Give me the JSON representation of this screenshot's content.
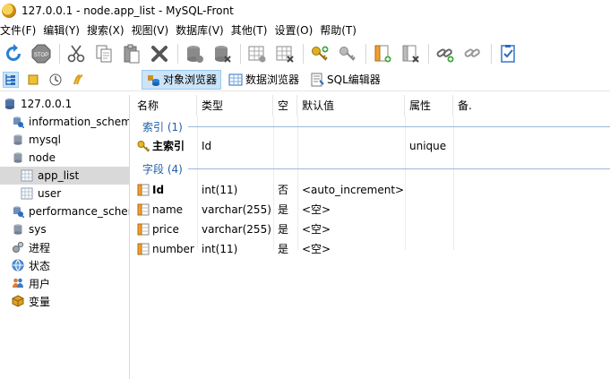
{
  "window": {
    "title": "127.0.0.1 - node.app_list - MySQL-Front"
  },
  "menu": [
    "文件(F)",
    "编辑(Y)",
    "搜索(X)",
    "视图(V)",
    "数据库(V)",
    "其他(T)",
    "设置(O)",
    "帮助(T)"
  ],
  "toolbar": {
    "icons": [
      "refresh-icon",
      "stop-icon",
      "cut-icon",
      "copy-icon",
      "paste-icon",
      "delete-icon",
      "new-database-icon",
      "drop-database-icon",
      "new-table-icon",
      "drop-table-icon",
      "new-key-icon",
      "drop-key-icon",
      "new-field-icon",
      "drop-field-icon",
      "new-link-icon",
      "drop-link-icon",
      "properties-icon"
    ],
    "stop_label": "STOP"
  },
  "view_tabs": [
    {
      "label": "对象浏览器",
      "active": true
    },
    {
      "label": "数据浏览器",
      "active": false
    },
    {
      "label": "SQL编辑器",
      "active": false
    }
  ],
  "tree": {
    "items": [
      {
        "label": "127.0.0.1",
        "level": 0,
        "icon": "server-icon"
      },
      {
        "label": "information_schem",
        "level": 1,
        "icon": "database-system-icon"
      },
      {
        "label": "mysql",
        "level": 1,
        "icon": "database-icon"
      },
      {
        "label": "node",
        "level": 1,
        "icon": "database-icon"
      },
      {
        "label": "app_list",
        "level": 2,
        "icon": "table-icon",
        "selected": true
      },
      {
        "label": "user",
        "level": 2,
        "icon": "table-icon"
      },
      {
        "label": "performance_scher",
        "level": 1,
        "icon": "database-system-icon"
      },
      {
        "label": "sys",
        "level": 1,
        "icon": "database-icon"
      },
      {
        "label": "进程",
        "level": 1,
        "icon": "process-icon"
      },
      {
        "label": "状态",
        "level": 1,
        "icon": "status-icon"
      },
      {
        "label": "用户",
        "level": 1,
        "icon": "users-icon"
      },
      {
        "label": "变量",
        "level": 1,
        "icon": "variables-icon"
      }
    ]
  },
  "grid": {
    "columns": [
      "名称",
      "类型",
      "空",
      "默认值",
      "属性",
      "备."
    ],
    "index_section": "索引 (1)",
    "index_rows": [
      {
        "name": "主索引",
        "type": "Id",
        "null": "",
        "default": "",
        "attr": "unique"
      }
    ],
    "field_section": "字段 (4)",
    "field_rows": [
      {
        "name": "Id",
        "type": "int(11)",
        "null": "否",
        "default": "<auto_increment>",
        "primary": true
      },
      {
        "name": "name",
        "type": "varchar(255)",
        "null": "是",
        "default": "<空>"
      },
      {
        "name": "price",
        "type": "varchar(255)",
        "null": "是",
        "default": "<空>"
      },
      {
        "name": "number",
        "type": "int(11)",
        "null": "是",
        "default": "<空>"
      }
    ]
  }
}
